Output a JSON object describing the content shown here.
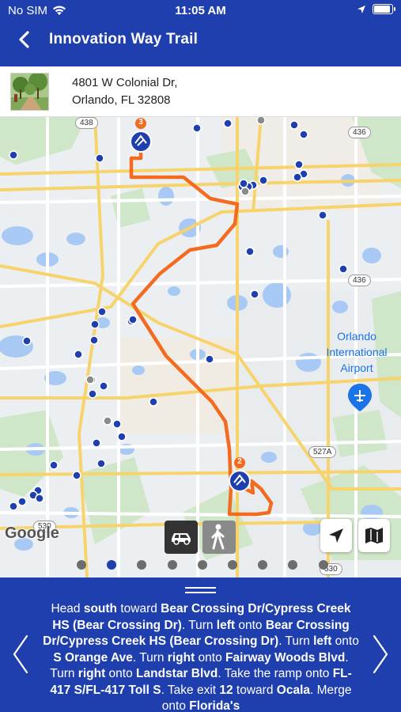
{
  "status": {
    "carrier": "No SIM",
    "time": "11:05 AM"
  },
  "header": {
    "title": "Innovation Way Trail"
  },
  "address": {
    "line1": "4801 W Colonial Dr,",
    "line2": "Orlando, FL 32808"
  },
  "map": {
    "labels": {
      "airport": "Orlando International Airport",
      "airport_l1": "Orlando",
      "airport_l2": "International",
      "airport_l3": "Airport"
    },
    "shields": [
      "438",
      "436",
      "436",
      "527A",
      "530",
      "530"
    ],
    "markers": [
      {
        "number": "3"
      },
      {
        "number": "2"
      }
    ],
    "attribution": "Google",
    "route_color": "#f26b21",
    "accent": "#1f3fae"
  },
  "mode_buttons": [
    "car-icon",
    "walk-icon"
  ],
  "pager": {
    "count": 9,
    "active_index": 1
  },
  "directions": {
    "segments": [
      {
        "t": "Head ",
        "b": false
      },
      {
        "t": "south",
        "b": true
      },
      {
        "t": " toward ",
        "b": false
      },
      {
        "t": "Bear Crossing Dr/Cypress Creek HS (Bear Crossing Dr)",
        "b": true
      },
      {
        "t": ". Turn ",
        "b": false
      },
      {
        "t": "left",
        "b": true
      },
      {
        "t": " onto ",
        "b": false
      },
      {
        "t": "Bear Crossing Dr/Cypress Creek HS (Bear Crossing Dr)",
        "b": true
      },
      {
        "t": ". Turn ",
        "b": false
      },
      {
        "t": "left",
        "b": true
      },
      {
        "t": " onto ",
        "b": false
      },
      {
        "t": "S Orange Ave",
        "b": true
      },
      {
        "t": ". Turn ",
        "b": false
      },
      {
        "t": "right",
        "b": true
      },
      {
        "t": " onto ",
        "b": false
      },
      {
        "t": "Fairway Woods Blvd",
        "b": true
      },
      {
        "t": ". Turn ",
        "b": false
      },
      {
        "t": "right",
        "b": true
      },
      {
        "t": " onto ",
        "b": false
      },
      {
        "t": "Landstar Blvd",
        "b": true
      },
      {
        "t": ". Take the ramp onto ",
        "b": false
      },
      {
        "t": "FL-417 S/FL-417 Toll S",
        "b": true
      },
      {
        "t": ". Take exit ",
        "b": false
      },
      {
        "t": "12",
        "b": true
      },
      {
        "t": " toward ",
        "b": false
      },
      {
        "t": "Ocala",
        "b": true
      },
      {
        "t": ". Merge onto ",
        "b": false
      },
      {
        "t": "Florida's",
        "b": true
      }
    ]
  }
}
